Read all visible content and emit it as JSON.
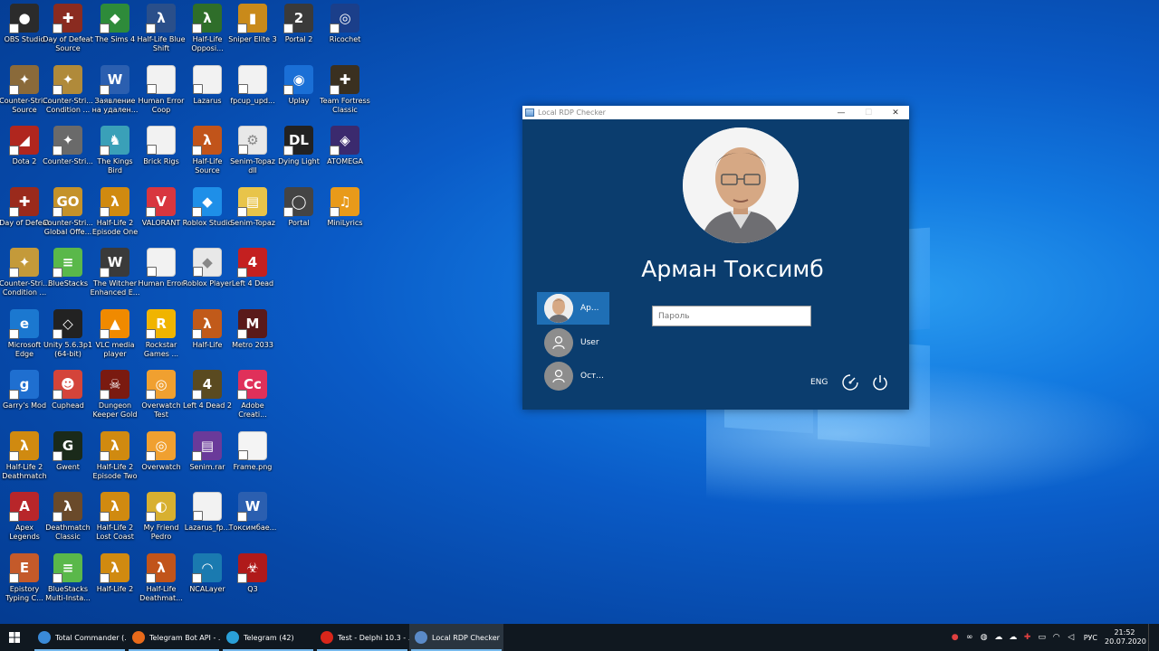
{
  "desktop_icons": [
    {
      "label": "OBS Studio",
      "color": "#2b2b2b",
      "glyph": "●"
    },
    {
      "label": "Day of Defeat Source",
      "color": "#8a2b20",
      "glyph": "✚"
    },
    {
      "label": "The Sims 4",
      "color": "#2e8b3a",
      "glyph": "◆"
    },
    {
      "label": "Half-Life Blue Shift",
      "color": "#2a4f8a",
      "glyph": "λ"
    },
    {
      "label": "Half-Life Opposi...",
      "color": "#2f6e2a",
      "glyph": "λ"
    },
    {
      "label": "Sniper Elite 3",
      "color": "#c98a1a",
      "glyph": "▮"
    },
    {
      "label": "Portal 2",
      "color": "#3a3a3a",
      "glyph": "2"
    },
    {
      "label": "Ricochet",
      "color": "#1b3f8a",
      "glyph": "◎"
    },
    {
      "label": "Counter-Stri... Source",
      "color": "#8a6a3a",
      "glyph": "✦"
    },
    {
      "label": "Counter-Stri... Condition ...",
      "color": "#b08a3a",
      "glyph": "✦"
    },
    {
      "label": "Заявление на удален...",
      "color": "#2b5fb0",
      "glyph": "W"
    },
    {
      "label": "Human Error Coop",
      "color": "#f2f2f2",
      "glyph": ""
    },
    {
      "label": "Lazarus",
      "color": "#f2f2f2",
      "glyph": ""
    },
    {
      "label": "fpcup_upd...",
      "color": "#f2f2f2",
      "glyph": ""
    },
    {
      "label": "Uplay",
      "color": "#1a6fd6",
      "glyph": "◉"
    },
    {
      "label": "Team Fortress Classic",
      "color": "#3a3020",
      "glyph": "✚"
    },
    {
      "label": "Dota 2",
      "color": "#b0261e",
      "glyph": "◢"
    },
    {
      "label": "Counter-Stri...",
      "color": "#6a6a6a",
      "glyph": "✦"
    },
    {
      "label": "The Kings Bird",
      "color": "#3aa0b8",
      "glyph": "♞"
    },
    {
      "label": "Brick Rigs",
      "color": "#f2f2f2",
      "glyph": ""
    },
    {
      "label": "Half-Life Source",
      "color": "#c1541a",
      "glyph": "λ"
    },
    {
      "label": "Senim-Topaz dll",
      "color": "#e8e8e8",
      "glyph": "⚙"
    },
    {
      "label": "Dying Light",
      "color": "#222222",
      "glyph": "DL"
    },
    {
      "label": "ATOMEGA",
      "color": "#3b2a6e",
      "glyph": "◈"
    },
    {
      "label": "Day of Defeat",
      "color": "#9a2a1c",
      "glyph": "✚"
    },
    {
      "label": "Counter-Stri... Global Offe...",
      "color": "#c4922a",
      "glyph": "GO"
    },
    {
      "label": "Half-Life 2 Episode One",
      "color": "#d08a10",
      "glyph": "λ"
    },
    {
      "label": "VALORANT",
      "color": "#d8363f",
      "glyph": "V"
    },
    {
      "label": "Roblox Studio",
      "color": "#1e8fe8",
      "glyph": "◆"
    },
    {
      "label": "Senim-Topaz",
      "color": "#e8c44a",
      "glyph": "▤"
    },
    {
      "label": "Portal",
      "color": "#444444",
      "glyph": "◯"
    },
    {
      "label": "MiniLyrics",
      "color": "#e89a1a",
      "glyph": "♫"
    },
    {
      "label": "Counter-Stri... Condition ...",
      "color": "#c49a3a",
      "glyph": "✦"
    },
    {
      "label": "BlueStacks",
      "color": "#5ab84a",
      "glyph": "≡"
    },
    {
      "label": "The Witcher Enhanced E...",
      "color": "#3a3a3a",
      "glyph": "W"
    },
    {
      "label": "Human Error",
      "color": "#f2f2f2",
      "glyph": ""
    },
    {
      "label": "Roblox Player",
      "color": "#e8e8e8",
      "glyph": "◆"
    },
    {
      "label": "Left 4 Dead",
      "color": "#c42020",
      "glyph": "4"
    },
    {
      "label": "Microsoft Edge",
      "color": "#1b78d0",
      "glyph": "e"
    },
    {
      "label": "Unity 5.6.3p1 (64-bit)",
      "color": "#222222",
      "glyph": "◇"
    },
    {
      "label": "VLC media player",
      "color": "#f08a00",
      "glyph": "▲"
    },
    {
      "label": "Rockstar Games ...",
      "color": "#f0b400",
      "glyph": "R"
    },
    {
      "label": "Half-Life",
      "color": "#c15a1a",
      "glyph": "λ"
    },
    {
      "label": "Metro 2033",
      "color": "#5a1a1a",
      "glyph": "M"
    },
    {
      "label": "Garry's Mod",
      "color": "#1f6fd0",
      "glyph": "g"
    },
    {
      "label": "Cuphead",
      "color": "#d4443a",
      "glyph": "☻"
    },
    {
      "label": "Dungeon Keeper Gold",
      "color": "#7a1a10",
      "glyph": "☠"
    },
    {
      "label": "Overwatch Test",
      "color": "#f0a030",
      "glyph": "◎"
    },
    {
      "label": "Left 4 Dead 2",
      "color": "#5a4a20",
      "glyph": "4"
    },
    {
      "label": "Adobe Creati...",
      "color": "#e0305a",
      "glyph": "Cc"
    },
    {
      "label": "Half-Life 2 Deathmatch",
      "color": "#d08a10",
      "glyph": "λ"
    },
    {
      "label": "Gwent",
      "color": "#1a2a1a",
      "glyph": "G"
    },
    {
      "label": "Half-Life 2 Episode Two",
      "color": "#d08a10",
      "glyph": "λ"
    },
    {
      "label": "Overwatch",
      "color": "#f0a030",
      "glyph": "◎"
    },
    {
      "label": "Senim.rar",
      "color": "#6a3a9a",
      "glyph": "▤"
    },
    {
      "label": "Frame.png",
      "color": "#f4f4f4",
      "glyph": ""
    },
    {
      "label": "Apex Legends",
      "color": "#b8262a",
      "glyph": "A"
    },
    {
      "label": "Deathmatch Classic",
      "color": "#6a4a2a",
      "glyph": "λ"
    },
    {
      "label": "Half-Life 2 Lost Coast",
      "color": "#d08a10",
      "glyph": "λ"
    },
    {
      "label": "My Friend Pedro",
      "color": "#d8b030",
      "glyph": "◐"
    },
    {
      "label": "Lazarus_fp...",
      "color": "#f2f2f2",
      "glyph": ""
    },
    {
      "label": "Токсимбае...",
      "color": "#2b5fb0",
      "glyph": "W"
    },
    {
      "label": "Epistory Typing C...",
      "color": "#c45a2a",
      "glyph": "E"
    },
    {
      "label": "BlueStacks Multi-Insta...",
      "color": "#5ab84a",
      "glyph": "≡"
    },
    {
      "label": "Half-Life 2",
      "color": "#d08a10",
      "glyph": "λ"
    },
    {
      "label": "Half-Life Deathmat...",
      "color": "#c1541a",
      "glyph": "λ"
    },
    {
      "label": "NCALayer",
      "color": "#1a7ab0",
      "glyph": "◠"
    },
    {
      "label": "Q3",
      "color": "#b01a1a",
      "glyph": "☣"
    }
  ],
  "dialog": {
    "title": "Local RDP Checker",
    "user_display_name": "Арман Токсимб",
    "password_placeholder": "Пароль",
    "language": "ENG",
    "users": [
      {
        "name": "Ар...",
        "selected": true
      },
      {
        "name": "User",
        "selected": false
      },
      {
        "name": "Ост...",
        "selected": false
      }
    ]
  },
  "taskbar": {
    "items": [
      {
        "label": "Total Commander (...",
        "color": "#3a8ad8"
      },
      {
        "label": "Telegram Bot API - ...",
        "color": "#e86a1a"
      },
      {
        "label": "Telegram (42)",
        "color": "#2aa0d8"
      },
      {
        "label": "Test - Delphi 10.3 - ...",
        "color": "#d8261a"
      },
      {
        "label": "Local RDP Checker",
        "color": "#5a8ac8"
      }
    ],
    "language": "РУС",
    "time": "21:52",
    "date": "20.07.2020"
  }
}
